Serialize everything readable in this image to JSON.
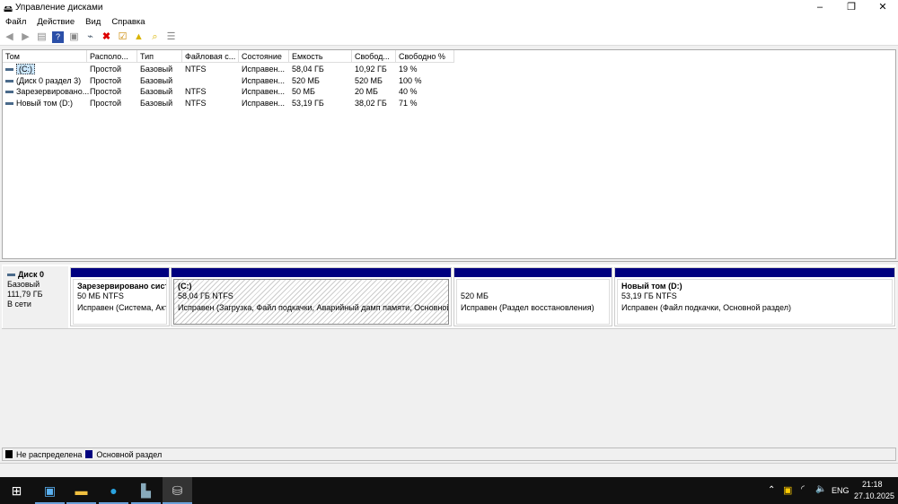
{
  "window": {
    "title": "Управление дисками",
    "minimize": "–",
    "maximize": "❐",
    "close": "✕"
  },
  "menu": [
    "Файл",
    "Действие",
    "Вид",
    "Справка"
  ],
  "columns": [
    "Том",
    "Располо...",
    "Тип",
    "Файловая с...",
    "Состояние",
    "Емкость",
    "Свобод...",
    "Свободно %"
  ],
  "volumes": [
    [
      "(C:)",
      "Простой",
      "Базовый",
      "NTFS",
      "Исправен...",
      "58,04 ГБ",
      "10,92 ГБ",
      "19 %"
    ],
    [
      "(Диск 0 раздел 3)",
      "Простой",
      "Базовый",
      "",
      "Исправен...",
      "520 МБ",
      "520 МБ",
      "100 %"
    ],
    [
      "Зарезервировано...",
      "Простой",
      "Базовый",
      "NTFS",
      "Исправен...",
      "50 МБ",
      "20 МБ",
      "40 %"
    ],
    [
      "Новый том (D:)",
      "Простой",
      "Базовый",
      "NTFS",
      "Исправен...",
      "53,19 ГБ",
      "38,02 ГБ",
      "71 %"
    ]
  ],
  "disk": {
    "name": "Диск 0",
    "type": "Базовый",
    "size": "111,79 ГБ",
    "status": "В сети"
  },
  "partitions": [
    {
      "name": "Зарезервировано систе",
      "size": "50 МБ NTFS",
      "status": "Исправен (Система, Акть"
    },
    {
      "name": "(C:)",
      "size": "58,04 ГБ NTFS",
      "status": "Исправен (Загрузка, Файл подкачки, Аварийный дамп памяти, Основной р"
    },
    {
      "name": "",
      "size": "520 МБ",
      "status": "Исправен (Раздел восстановления)"
    },
    {
      "name": "Новый том  (D:)",
      "size": "53,19 ГБ NTFS",
      "status": "Исправен (Файл подкачки, Основной раздел)"
    }
  ],
  "legend": [
    {
      "label": "Не распределена",
      "color": "#000000"
    },
    {
      "label": "Основной раздел",
      "color": "#00007f"
    }
  ],
  "taskbar": {
    "time": "21:18",
    "date": "27.10.2025",
    "lang": "ENG"
  }
}
